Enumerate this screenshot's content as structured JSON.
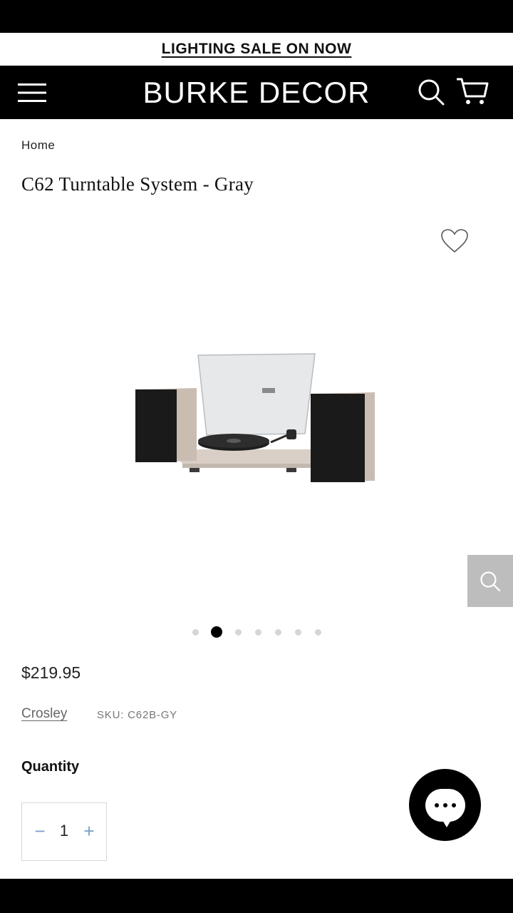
{
  "promo": {
    "text": "LIGHTING SALE ON NOW"
  },
  "header": {
    "brand": "BURKE DECOR",
    "menu_icon": "hamburger-menu-icon",
    "search_icon": "search-icon",
    "cart_icon": "cart-icon"
  },
  "breadcrumb": {
    "home": "Home"
  },
  "product": {
    "title": "C62 Turntable System - Gray",
    "wishlist_icon": "heart-icon",
    "zoom_icon": "search-icon",
    "image": "turntable-with-speakers",
    "gallery": {
      "total": 7,
      "active_index": 1
    },
    "price": "$219.95",
    "vendor": "Crosley",
    "sku": "SKU: C62B-GY"
  },
  "quantity": {
    "label": "Quantity",
    "value": "1",
    "minus": "−",
    "plus": "+"
  },
  "chat": {
    "icon": "chat-bubble-icon"
  },
  "colors": {
    "header_bg": "#000000",
    "qty_controls": "#7ea0c8",
    "zoom_bg": "#bdbdbd"
  }
}
